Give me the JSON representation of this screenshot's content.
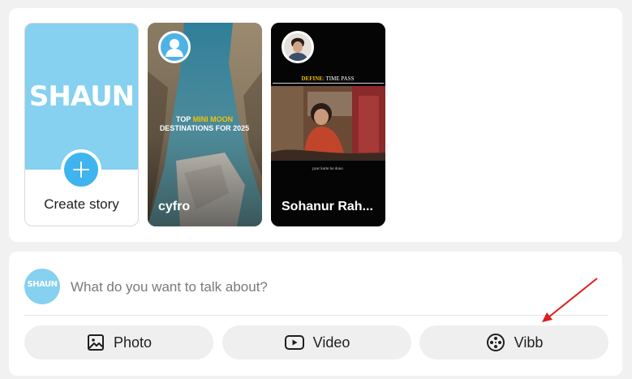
{
  "stories": {
    "create": {
      "logo_text": "SHAUN",
      "label": "Create story"
    },
    "items": [
      {
        "name": "cyfro",
        "thumbnail_text_line1_a": "TOP ",
        "thumbnail_text_line1_b": "MINI MOON",
        "thumbnail_text_line2": "DESTINATIONS FOR 2025"
      },
      {
        "name": "Sohanur Rah...",
        "thumbnail_caption_a": "DEFINE",
        "thumbnail_caption_b": ": TIME PASS",
        "thumbnail_subtitle": "pyar karte ho dono"
      }
    ]
  },
  "composer": {
    "avatar_text": "SHAUN",
    "placeholder": "What do you want to talk about?",
    "actions": [
      {
        "label": "Photo",
        "icon": "image-icon"
      },
      {
        "label": "Video",
        "icon": "video-icon"
      },
      {
        "label": "Vibb",
        "icon": "film-reel-icon"
      }
    ]
  },
  "colors": {
    "brand_light_blue": "#86d0f0",
    "plus_button_blue": "#3fb4ee",
    "annotation_arrow": "#e01b1b"
  }
}
